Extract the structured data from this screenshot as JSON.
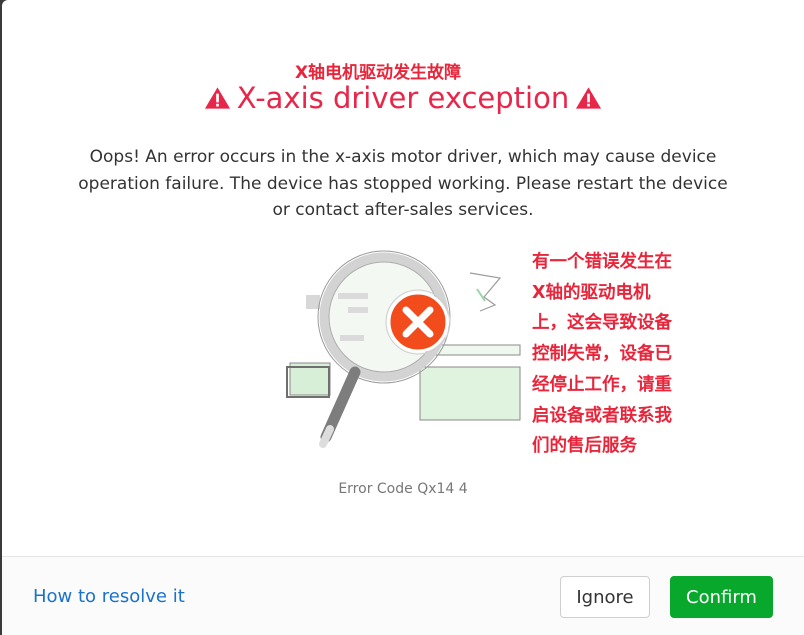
{
  "annotation_title_cn": "X轴电机驱动发生故障",
  "title": "X-axis driver exception",
  "message": "Oops! An error occurs in the x-axis motor driver, which may cause device operation failure. The device has stopped working. Please restart the device or contact after-sales services.",
  "annotation_body_cn": [
    "有一个错误发生在",
    "X轴的驱动电机",
    "上，这会导致设备",
    "控制失常，设备已",
    "经停止工作，请重",
    "启设备或者联系我",
    "们的售后服务"
  ],
  "error_code": "Error Code Qx14 4",
  "footer": {
    "resolve_link": "How to resolve it",
    "ignore_label": "Ignore",
    "confirm_label": "Confirm"
  },
  "colors": {
    "title_red": "#e8264a",
    "annotation_red": "#e8263b",
    "confirm_green": "#08a82c",
    "link_blue": "#1a73c9",
    "error_circle": "#f24b1c"
  },
  "icons": [
    "warning-icon",
    "magnifier-error-illustration",
    "x-error-icon"
  ]
}
